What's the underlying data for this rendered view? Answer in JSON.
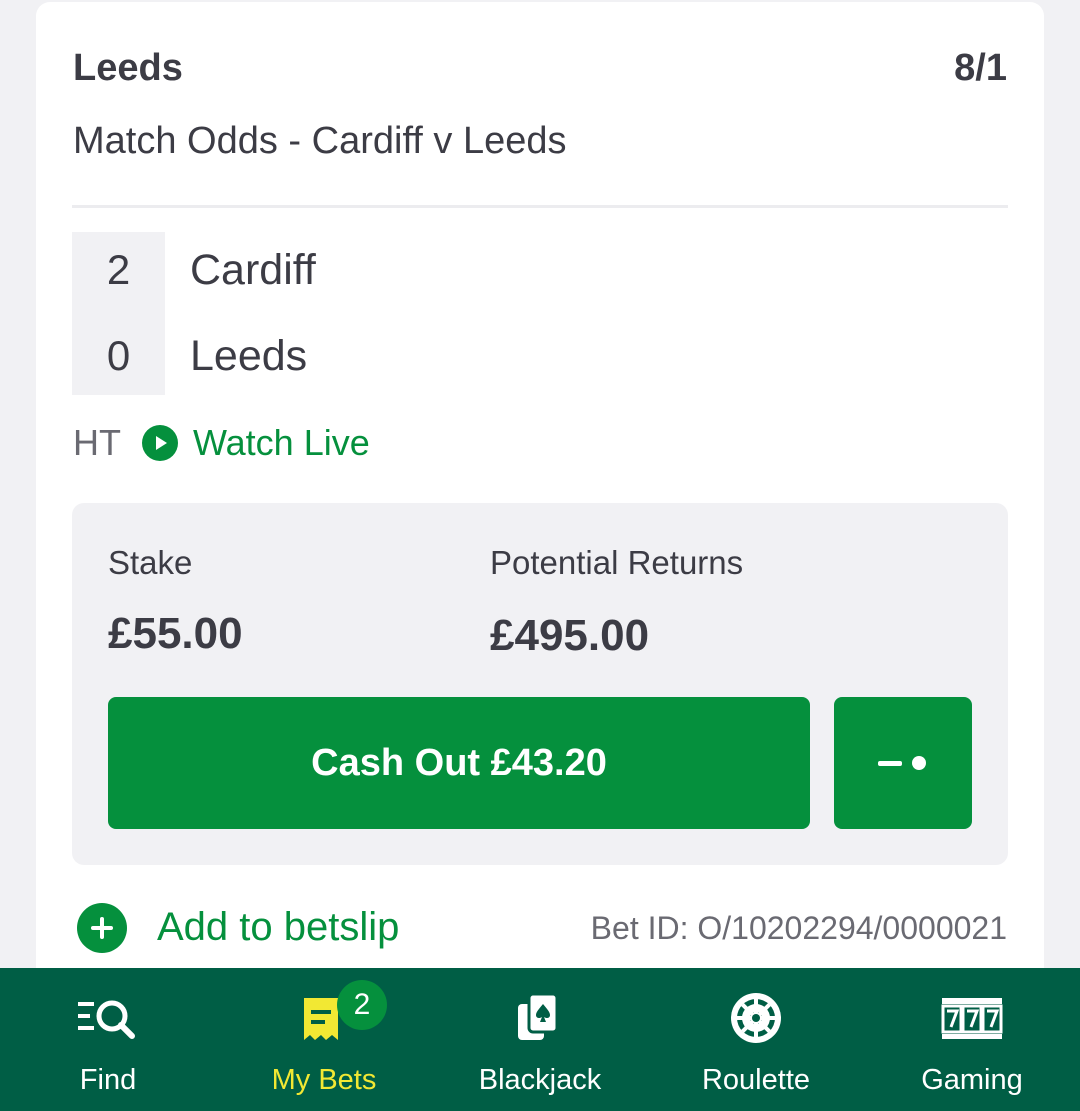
{
  "bet": {
    "selection": "Leeds",
    "odds": "8/1",
    "market": "Match Odds - Cardiff v Leeds"
  },
  "scoreboard": {
    "home": {
      "score": "2",
      "team": "Cardiff"
    },
    "away": {
      "score": "0",
      "team": "Leeds"
    },
    "period": "HT",
    "watch_label": "Watch Live"
  },
  "stake_panel": {
    "stake_label": "Stake",
    "stake_value": "£55.00",
    "returns_label": "Potential Returns",
    "returns_value": "£495.00",
    "cashout_label": "Cash Out £43.20"
  },
  "footer": {
    "add_label": "Add to betslip",
    "bet_id": "Bet ID: O/10202294/0000021"
  },
  "nav": {
    "items": [
      {
        "label": "Find",
        "icon": "search-list-icon"
      },
      {
        "label": "My Bets",
        "icon": "bet-slip-icon",
        "badge": "2",
        "active": true
      },
      {
        "label": "Blackjack",
        "icon": "cards-icon"
      },
      {
        "label": "Roulette",
        "icon": "roulette-icon"
      },
      {
        "label": "Gaming",
        "icon": "slots-777-icon"
      }
    ]
  },
  "colors": {
    "brand_green": "#05903d",
    "nav_background": "#005e45",
    "active_nav": "#f2e833"
  }
}
